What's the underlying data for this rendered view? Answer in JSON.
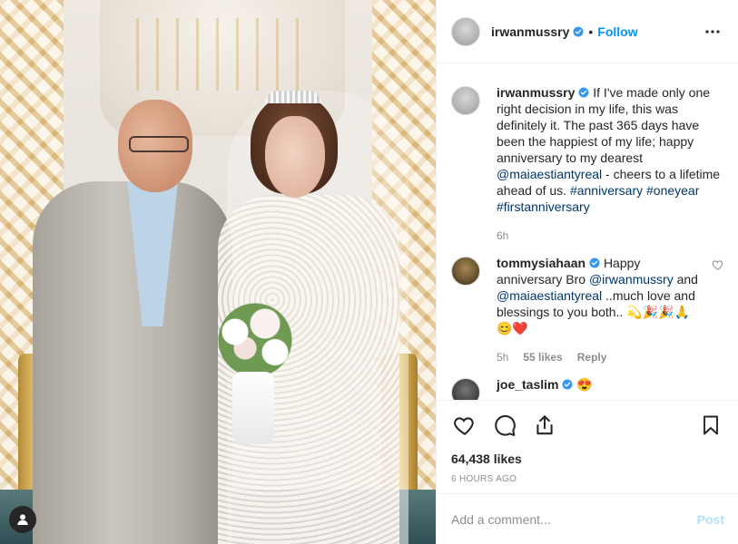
{
  "colors": {
    "accent": "#0095f6",
    "link": "#00376b",
    "heart": "#ed4956",
    "muted": "#8e8e8e",
    "post_disabled": "#b2dffc"
  },
  "header": {
    "username": "irwanmussry",
    "separator": "•",
    "follow_label": "Follow",
    "more_icon": "ellipsis-icon"
  },
  "caption": {
    "username": "irwanmussry",
    "text_before_mention": "If I've made only one right decision in my life, this was definitely it. The past 365 days have been the happiest of my life; happy anniversary to my dearest",
    "mention": "@maiaestiantyreal",
    "text_after_mention": " - cheers to a lifetime ahead of us.",
    "hashtags": [
      "#anniversary",
      "#oneyear",
      "#firstanniversary"
    ],
    "time": "6h"
  },
  "comments": [
    {
      "username": "tommysiahaan",
      "text_1": "Happy anniversary Bro",
      "mention_1": "@irwanmussry",
      "text_2": "and",
      "mention_2": "@maiaestiantyreal",
      "text_3": "..much love and blessings to you both..",
      "emojis": "💫🎉🎉🙏😊❤️",
      "time": "5h",
      "likes": "55 likes",
      "reply_label": "Reply"
    },
    {
      "username": "joe_taslim",
      "emojis": "😍"
    }
  ],
  "actions": {
    "like_icon": "heart-icon",
    "comment_icon": "comment-icon",
    "share_icon": "share-icon",
    "save_icon": "bookmark-icon"
  },
  "likes": "64,438 likes",
  "timestamp": "6 HOURS AGO",
  "add_comment": {
    "placeholder": "Add a comment...",
    "post_label": "Post"
  }
}
